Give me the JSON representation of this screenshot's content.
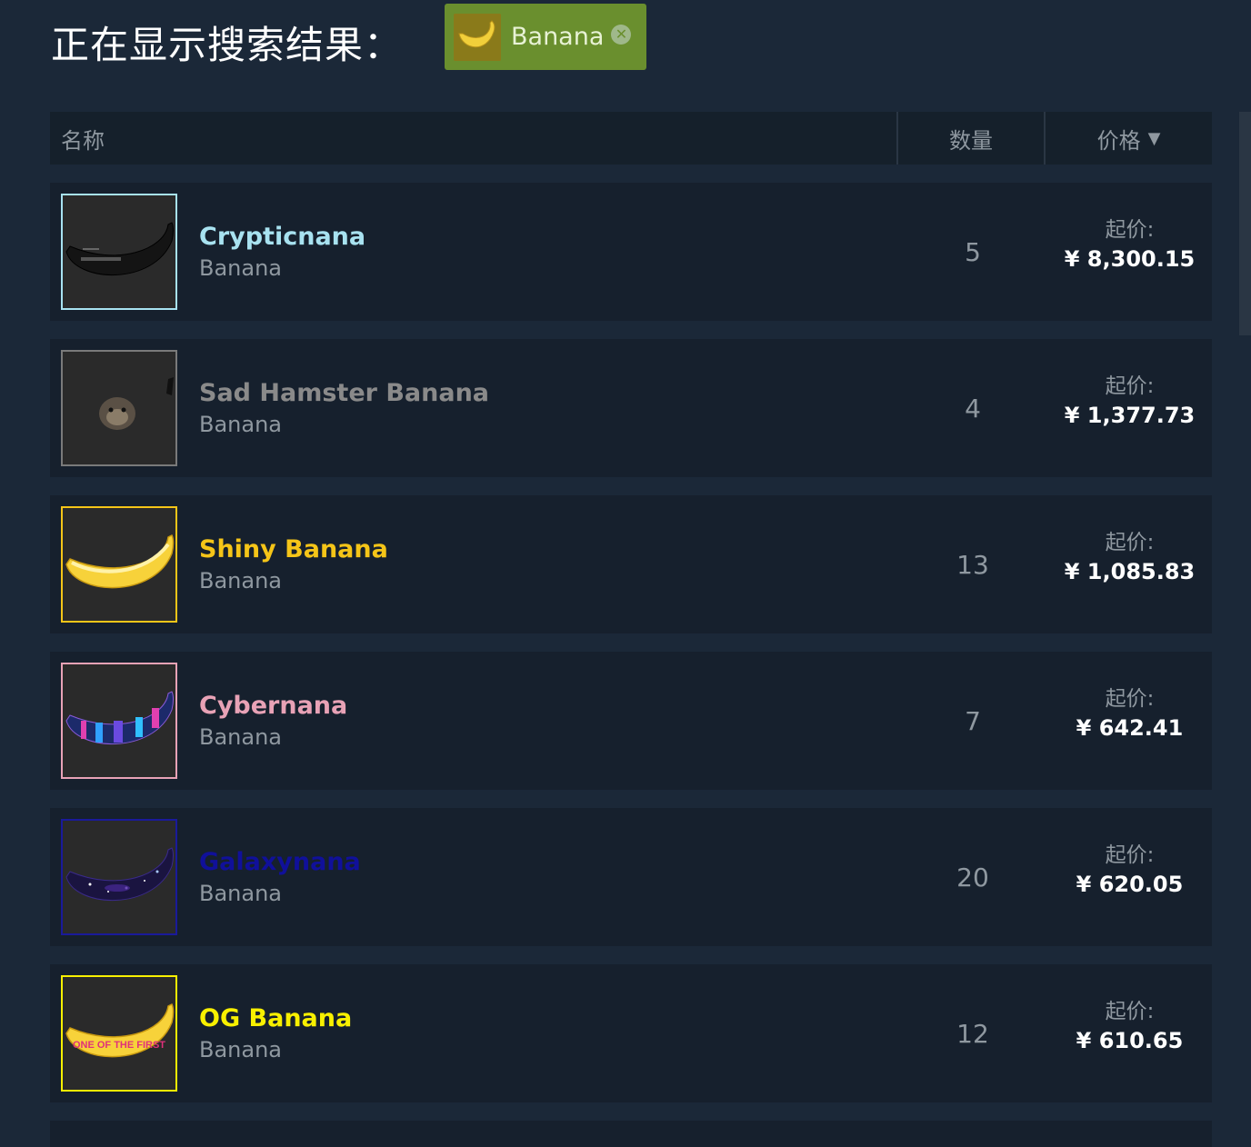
{
  "header": {
    "title": "正在显示搜索结果："
  },
  "filter": {
    "label": "Banana",
    "close_glyph": "✕",
    "icon": "banana-icon"
  },
  "table": {
    "col_name": "名称",
    "col_qty": "数量",
    "col_price": "价格",
    "sort_glyph": "▼"
  },
  "rows": [
    {
      "name": "Crypticnana",
      "game": "Banana",
      "qty": "5",
      "price_label": "起价:",
      "price": "¥ 8,300.15",
      "name_color": "#a8e2f0",
      "border_color": "#a8e2f0",
      "banana_style": "dark"
    },
    {
      "name": "Sad Hamster Banana",
      "game": "Banana",
      "qty": "4",
      "price_label": "起价:",
      "price": "¥ 1,377.73",
      "name_color": "#8a8a8a",
      "border_color": "#7a7a7a",
      "banana_style": "hamster"
    },
    {
      "name": "Shiny Banana",
      "game": "Banana",
      "qty": "13",
      "price_label": "起价:",
      "price": "¥ 1,085.83",
      "name_color": "#f5c518",
      "border_color": "#f5c518",
      "banana_style": "yellow"
    },
    {
      "name": "Cybernana",
      "game": "Banana",
      "qty": "7",
      "price_label": "起价:",
      "price": "¥ 642.41",
      "name_color": "#e8a2b6",
      "border_color": "#e8a2b6",
      "banana_style": "cyber"
    },
    {
      "name": "Galaxynana",
      "game": "Banana",
      "qty": "20",
      "price_label": "起价:",
      "price": "¥ 620.05",
      "name_color": "#10109a",
      "border_color": "#1a1a9a",
      "banana_style": "galaxy"
    },
    {
      "name": "OG Banana",
      "game": "Banana",
      "qty": "12",
      "price_label": "起价:",
      "price": "¥ 610.65",
      "name_color": "#f8f000",
      "border_color": "#f8f000",
      "banana_style": "og",
      "banner_text": "ONE OF THE FIRST"
    }
  ]
}
